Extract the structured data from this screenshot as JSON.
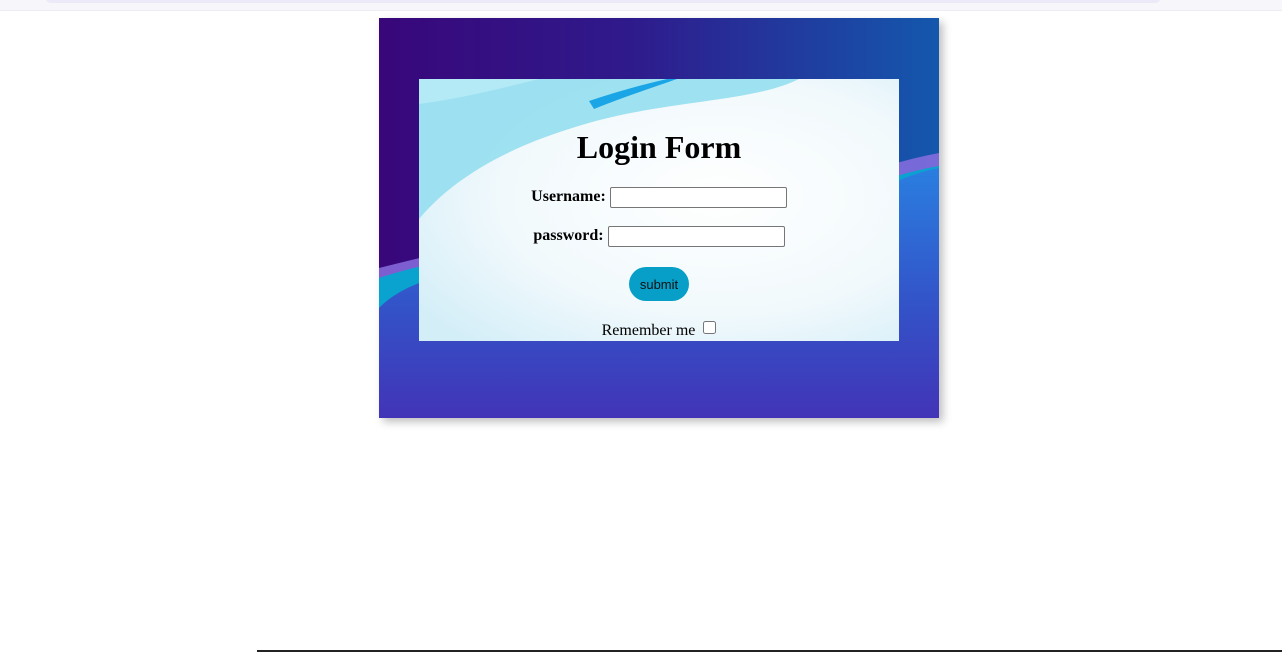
{
  "form": {
    "title": "Login Form",
    "username_label": "Username:",
    "username_value": "",
    "password_label": "password:",
    "password_value": "",
    "submit_label": "submit",
    "remember_label": "Remember me",
    "remember_checked": false
  },
  "colors": {
    "panel_gradient_top": "#38077a",
    "panel_gradient_right": "#1458ad",
    "wave_blue": "#1f7fe0",
    "panel_bottom": "#4234b7",
    "submit_bg": "#079ec8"
  }
}
